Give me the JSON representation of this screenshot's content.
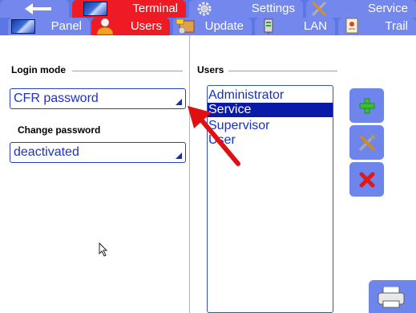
{
  "topTabs": [
    {
      "icon": "back-arrow-icon",
      "label": ""
    },
    {
      "icon": "panel-icon",
      "label": "Terminal"
    },
    {
      "icon": "gear-icon",
      "label": "Settings"
    },
    {
      "icon": "tools-icon",
      "label": "Service"
    }
  ],
  "subTabs": [
    {
      "icon": "panel-icon",
      "label": "Panel"
    },
    {
      "icon": "user-icon",
      "label": "Users"
    },
    {
      "icon": "update-box-icon",
      "label": "Update"
    },
    {
      "icon": "network-server-icon",
      "label": "LAN"
    },
    {
      "icon": "certificate-icon",
      "label": "Trail"
    }
  ],
  "login": {
    "group_title": "Login mode",
    "mode_value": "CFR password",
    "change_label": "Change password",
    "change_value": "deactivated"
  },
  "users": {
    "group_title": "Users",
    "items": [
      "Administrator",
      "Service",
      "Supervisor",
      "User"
    ],
    "selected_index": 1
  },
  "colors": {
    "bar": "#5d76e6",
    "tab_active": "#ee1b24",
    "tab": "#7487ec",
    "text_blue": "#2030c8",
    "selection": "#0a1aa8",
    "button": "#6e86ec",
    "annotation_arrow": "#e01010"
  }
}
